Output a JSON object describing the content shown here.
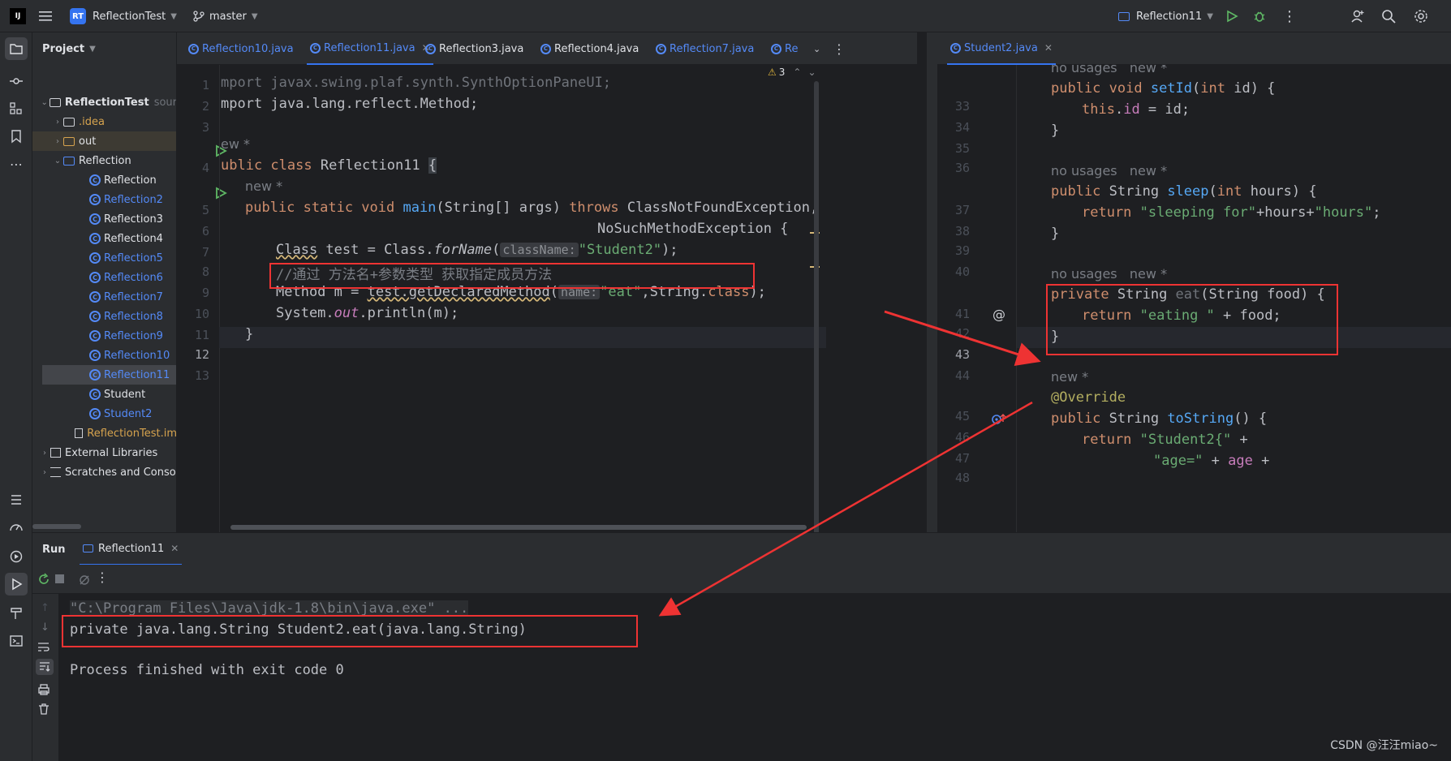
{
  "titlebar": {
    "app_logo": "IJ",
    "project_badge": "RT",
    "project_name": "ReflectionTest",
    "branch": "master",
    "run_config": "Reflection11"
  },
  "project_panel": {
    "title": "Project",
    "items": [
      {
        "label": "ReflectionTest",
        "suffix": "sour"
      },
      {
        "label": ".idea"
      },
      {
        "label": "out"
      },
      {
        "label": "Reflection"
      },
      {
        "label": "Reflection"
      },
      {
        "label": "Reflection2"
      },
      {
        "label": "Reflection3"
      },
      {
        "label": "Reflection4"
      },
      {
        "label": "Reflection5"
      },
      {
        "label": "Reflection6"
      },
      {
        "label": "Reflection7"
      },
      {
        "label": "Reflection8"
      },
      {
        "label": "Reflection9"
      },
      {
        "label": "Reflection10"
      },
      {
        "label": "Reflection11"
      },
      {
        "label": "Student"
      },
      {
        "label": "Student2"
      },
      {
        "label": "ReflectionTest.im"
      },
      {
        "label": "External Libraries"
      },
      {
        "label": "Scratches and Conso"
      }
    ]
  },
  "tabs_left": [
    "Reflection10.java",
    "Reflection11.java",
    "Reflection3.java",
    "Reflection4.java",
    "Reflection7.java",
    "Re"
  ],
  "tabs_right": [
    "Student2.java"
  ],
  "editor_left": {
    "warnings": "3",
    "line_numbers": [
      "1",
      "2",
      "3",
      "4",
      "5",
      "6",
      "7",
      "8",
      "9",
      "10",
      "11",
      "12",
      "13"
    ],
    "inlay_hints": {
      "classname": "className:",
      "name": "name:"
    },
    "usages_new": "ew *",
    "usages_new2": "new *"
  },
  "editor_right": {
    "line_numbers": [
      "33",
      "34",
      "35",
      "36",
      "37",
      "38",
      "39",
      "40",
      "41",
      "42",
      "43",
      "44",
      "45",
      "46",
      "47",
      "48"
    ],
    "no_usages": "no usages",
    "new_star": "new *"
  },
  "run_panel": {
    "title": "Run",
    "tab": "Reflection11",
    "console": [
      "\"C:\\Program Files\\Java\\jdk-1.8\\bin\\java.exe\" ...",
      "private java.lang.String Student2.eat(java.lang.String)",
      "",
      "Process finished with exit code 0"
    ]
  },
  "watermark": "CSDN @汪汪miao~"
}
